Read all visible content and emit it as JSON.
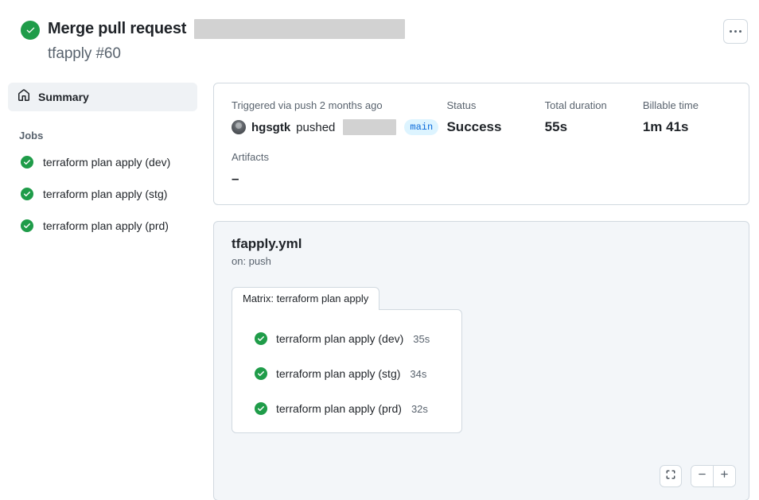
{
  "header": {
    "status_icon": "success-check-icon",
    "title": "Merge pull request",
    "title_redacted": true,
    "subtitle": "tfapply #60",
    "kebab_label": "More options",
    "kebab_icon": "kebab-horizontal-icon"
  },
  "sidebar": {
    "summary": {
      "label": "Summary",
      "icon": "home-icon"
    },
    "jobs_heading": "Jobs",
    "jobs": [
      {
        "label": "terraform plan apply (dev)",
        "icon": "success-check-icon"
      },
      {
        "label": "terraform plan apply (stg)",
        "icon": "success-check-icon"
      },
      {
        "label": "terraform plan apply (prd)",
        "icon": "success-check-icon"
      }
    ]
  },
  "summary_card": {
    "trigger_label": "Triggered via push 2 months ago",
    "pusher_name": "hgsgtk",
    "pushed_word": "pushed",
    "commit_redacted": true,
    "branch": "main",
    "status_label": "Status",
    "status_value": "Success",
    "duration_label": "Total duration",
    "duration_value": "55s",
    "billable_label": "Billable time",
    "billable_value": "1m 41s",
    "artifacts_label": "Artifacts",
    "artifacts_value": "–"
  },
  "graph": {
    "workflow_file": "tfapply.yml",
    "trigger": "on: push",
    "matrix_label": "Matrix: terraform plan apply",
    "nodes": [
      {
        "label": "terraform plan apply (dev)",
        "time": "35s",
        "icon": "success-check-icon"
      },
      {
        "label": "terraform plan apply (stg)",
        "time": "34s",
        "icon": "success-check-icon"
      },
      {
        "label": "terraform plan apply (prd)",
        "time": "32s",
        "icon": "success-check-icon"
      }
    ],
    "controls": {
      "fullscreen_icon": "fullscreen-icon",
      "zoom_out_icon": "minus-icon",
      "zoom_in_icon": "plus-icon"
    }
  },
  "colors": {
    "success_green": "#1f9c49",
    "link_blue": "#0969da",
    "branch_bg": "#ddf4ff",
    "border": "#d1d9e0",
    "panel_bg": "#f3f6f9",
    "muted_text": "#59636e"
  }
}
